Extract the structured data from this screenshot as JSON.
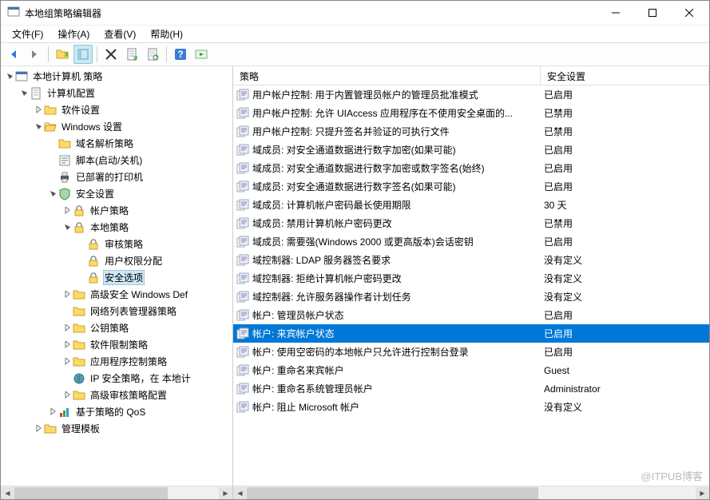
{
  "window": {
    "title": "本地组策略编辑器"
  },
  "menu": {
    "file": "文件(F)",
    "action": "操作(A)",
    "view": "查看(V)",
    "help": "帮助(H)"
  },
  "tree": {
    "root": "本地计算机 策略"
  },
  "t": {
    "n1": "计算机配置",
    "n1a": "软件设置",
    "n1b": "Windows 设置",
    "n1b1": "域名解析策略",
    "n1b2": "脚本(启动/关机)",
    "n1b3": "已部署的打印机",
    "n1b4": "安全设置",
    "n1b4a": "帐户策略",
    "n1b4b": "本地策略",
    "n1b4b1": "审核策略",
    "n1b4b2": "用户权限分配",
    "n1b4b3": "安全选项",
    "n1b4c": "高级安全 Windows Def",
    "n1b4d": "网络列表管理器策略",
    "n1b4e": "公钥策略",
    "n1b4f": "软件限制策略",
    "n1b4g": "应用程序控制策略",
    "n1b4h": "IP 安全策略，在 本地计",
    "n1b4i": "高级审核策略配置",
    "n1b5": "基于策略的 QoS",
    "n1c": "管理模板"
  },
  "listHeader": {
    "policy": "策略",
    "setting": "安全设置"
  },
  "policies": [
    {
      "name": "用户帐户控制: 用于内置管理员帐户的管理员批准模式",
      "value": "已启用"
    },
    {
      "name": "用户帐户控制: 允许 UIAccess 应用程序在不使用安全桌面的...",
      "value": "已禁用"
    },
    {
      "name": "用户帐户控制: 只提升签名并验证的可执行文件",
      "value": "已禁用"
    },
    {
      "name": "域成员: 对安全通道数据进行数字加密(如果可能)",
      "value": "已启用"
    },
    {
      "name": "域成员: 对安全通道数据进行数字加密或数字签名(始终)",
      "value": "已启用"
    },
    {
      "name": "域成员: 对安全通道数据进行数字签名(如果可能)",
      "value": "已启用"
    },
    {
      "name": "域成员: 计算机帐户密码最长使用期限",
      "value": "30 天"
    },
    {
      "name": "域成员: 禁用计算机帐户密码更改",
      "value": "已禁用"
    },
    {
      "name": "域成员: 需要强(Windows 2000 或更高版本)会话密钥",
      "value": "已启用"
    },
    {
      "name": "域控制器: LDAP 服务器签名要求",
      "value": "没有定义"
    },
    {
      "name": "域控制器: 拒绝计算机帐户密码更改",
      "value": "没有定义"
    },
    {
      "name": "域控制器: 允许服务器操作者计划任务",
      "value": "没有定义"
    },
    {
      "name": "帐户: 管理员帐户状态",
      "value": "已启用"
    },
    {
      "name": "帐户: 来宾帐户状态",
      "value": "已启用",
      "selected": true
    },
    {
      "name": "帐户: 使用空密码的本地帐户只允许进行控制台登录",
      "value": "已启用"
    },
    {
      "name": "帐户: 重命名来宾帐户",
      "value": "Guest"
    },
    {
      "name": "帐户: 重命名系统管理员帐户",
      "value": "Administrator"
    },
    {
      "name": "帐户: 阻止 Microsoft 帐户",
      "value": "没有定义"
    }
  ],
  "watermark": "@ITPUB博客"
}
